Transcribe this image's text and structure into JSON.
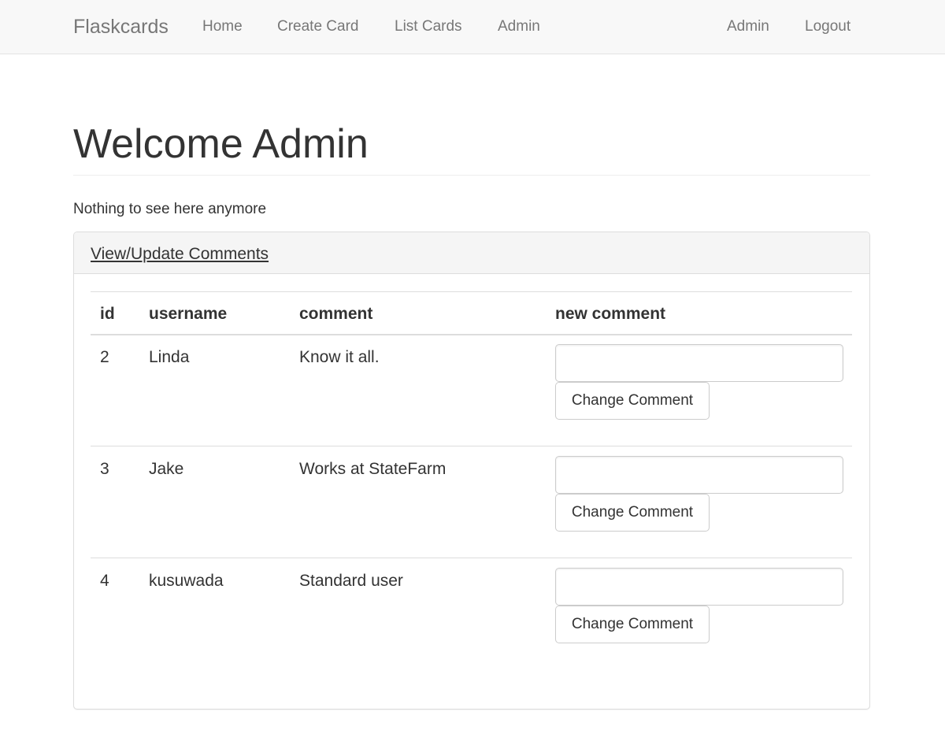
{
  "navbar": {
    "brand": "Flaskcards",
    "links": [
      "Home",
      "Create Card",
      "List Cards",
      "Admin"
    ],
    "right_links": [
      "Admin",
      "Logout"
    ]
  },
  "page": {
    "title": "Welcome Admin",
    "intro": "Nothing to see here anymore"
  },
  "panel": {
    "heading": "View/Update Comments",
    "columns": [
      "id",
      "username",
      "comment",
      "new comment"
    ],
    "rows": [
      {
        "id": "2",
        "username": "Linda",
        "comment": "Know it all.",
        "new_comment": "",
        "button": "Change Comment"
      },
      {
        "id": "3",
        "username": "Jake",
        "comment": "Works at StateFarm",
        "new_comment": "",
        "button": "Change Comment"
      },
      {
        "id": "4",
        "username": "kusuwada",
        "comment": "Standard user",
        "new_comment": "",
        "button": "Change Comment"
      }
    ]
  }
}
